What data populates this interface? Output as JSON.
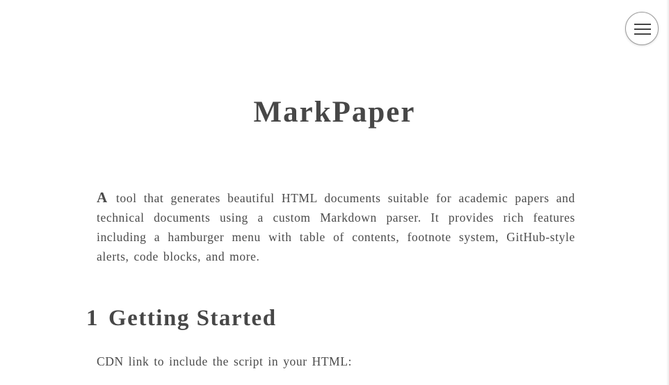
{
  "menu": {
    "icon": "hamburger-menu-icon"
  },
  "document": {
    "title": "MarkPaper",
    "intro": {
      "dropcap": "A",
      "text": " tool that generates beautiful HTML documents suitable for academic papers and technical documents using a custom Markdown parser. It provides rich features including a hamburger menu with table of contents, footnote system, GitHub-style alerts, code blocks, and more."
    },
    "sections": [
      {
        "number": "1",
        "title": "Getting Started",
        "paragraph": "CDN link to include the script in your HTML:"
      }
    ]
  }
}
